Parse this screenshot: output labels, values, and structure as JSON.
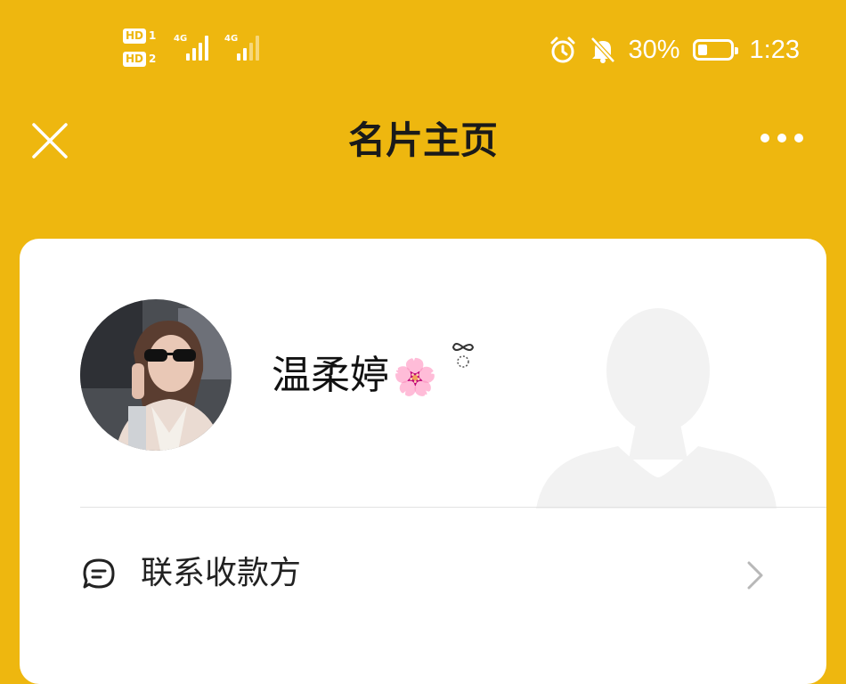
{
  "status_bar": {
    "sim1_label": "HD",
    "sim1_num": "1",
    "sim2_label": "HD",
    "sim2_num": "2",
    "net1": "4G",
    "net2": "4G",
    "battery_text": "30%",
    "battery_level": 0.3,
    "time": "1:23",
    "icons": [
      "alarm-icon",
      "bell-muted-icon"
    ]
  },
  "header": {
    "title": "名片主页",
    "close_icon": "close-icon",
    "more_icon": "more-icon"
  },
  "card": {
    "profile_name": "温柔婷",
    "name_decoration": "🌸",
    "avatar_icon": "avatar",
    "contact_row": {
      "label": "联系收款方",
      "icon": "chat-bubble-icon",
      "chevron": "chevron-right-icon"
    }
  },
  "colors": {
    "background": "#EEB70F",
    "card": "#FFFFFF",
    "title_text": "#1A1A1A"
  }
}
